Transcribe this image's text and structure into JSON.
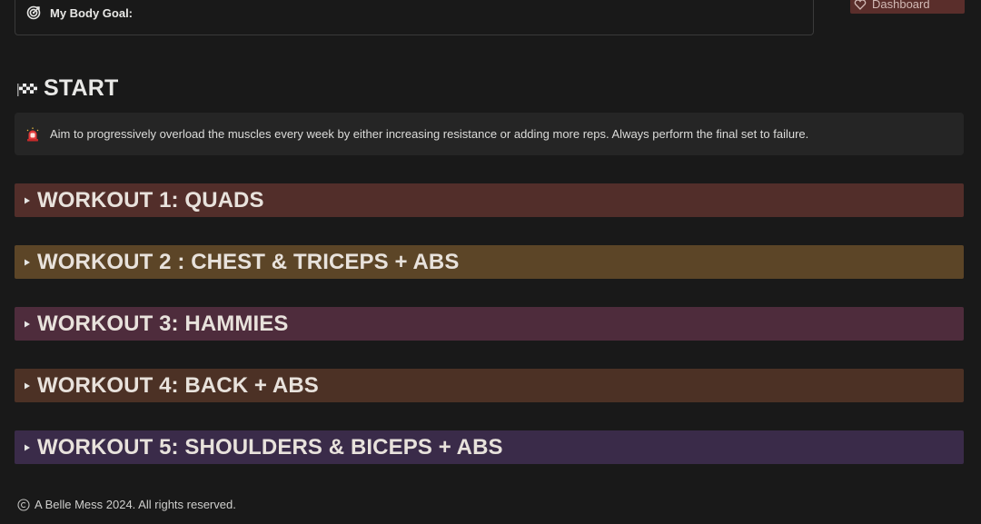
{
  "goal": {
    "label": "My Body Goal:",
    "icon": "target-icon"
  },
  "dashboard_button": {
    "label": "Dashboard",
    "icon": "heart-icon",
    "color": "#5a2e2b"
  },
  "start": {
    "title": "START",
    "icon": "checkered-flag-icon"
  },
  "callout": {
    "icon": "siren-icon",
    "text": "Aim to progressively overload the muscles every week by either increasing resistance or adding more reps. Always perform the final set to failure."
  },
  "workouts": [
    {
      "title": "WORKOUT 1: QUADS",
      "color": "#522e2a"
    },
    {
      "title": "WORKOUT 2 : CHEST & TRICEPS + ABS",
      "color": "#5c4527"
    },
    {
      "title": "WORKOUT 3: HAMMIES",
      "color": "#4e2c3c"
    },
    {
      "title": "WORKOUT 4: BACK + ABS",
      "color": "#4c3125"
    },
    {
      "title": "WORKOUT 5: SHOULDERS & BICEPS + ABS",
      "color": "#3a2b49"
    }
  ],
  "footer": {
    "icon": "copyright-icon",
    "text": "A Belle Mess 2024. All rights reserved."
  }
}
